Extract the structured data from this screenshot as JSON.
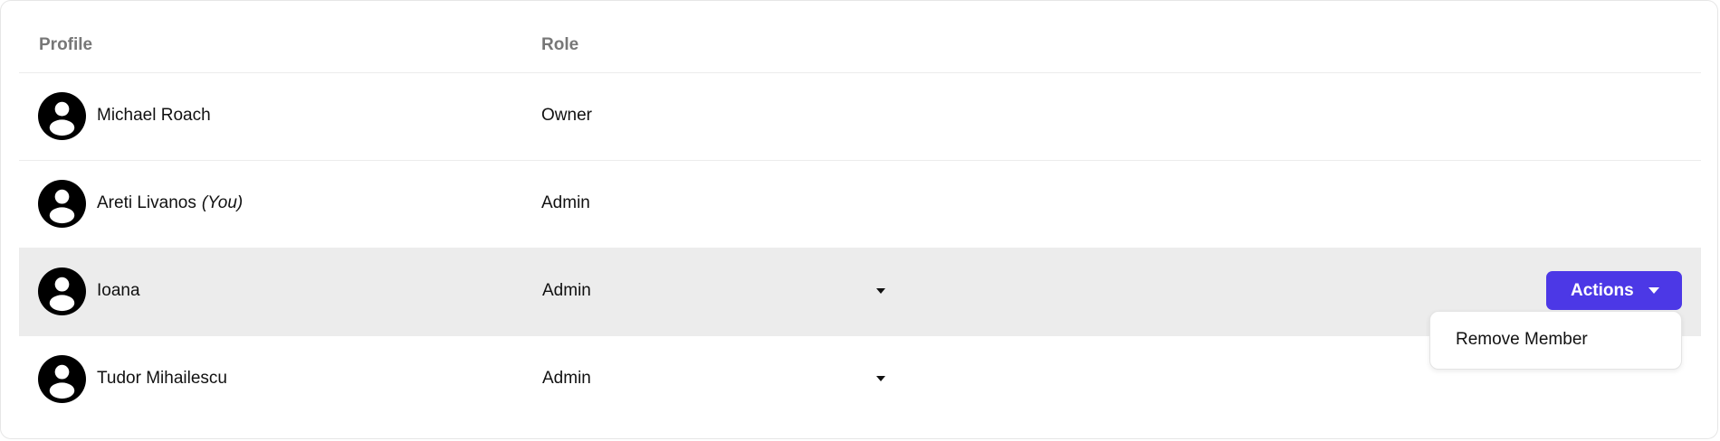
{
  "table": {
    "headers": {
      "profile": "Profile",
      "role": "Role"
    },
    "rows": [
      {
        "name": "Michael Roach",
        "you": "",
        "role": "Owner"
      },
      {
        "name": "Areti Livanos",
        "you": "(You)",
        "role": "Admin"
      },
      {
        "name": "Ioana",
        "you": "",
        "role": "Admin"
      },
      {
        "name": "Tudor Mihailescu",
        "you": "",
        "role": "Admin"
      }
    ]
  },
  "actions": {
    "label": "Actions"
  },
  "dropdown": {
    "items": [
      {
        "label": "Remove Member"
      }
    ]
  },
  "colors": {
    "accent": "#4c38e6",
    "row_highlight": "#ececec",
    "header_text": "#777777"
  },
  "icons": {
    "avatar": "user-avatar-icon",
    "caret": "caret-down-icon"
  }
}
